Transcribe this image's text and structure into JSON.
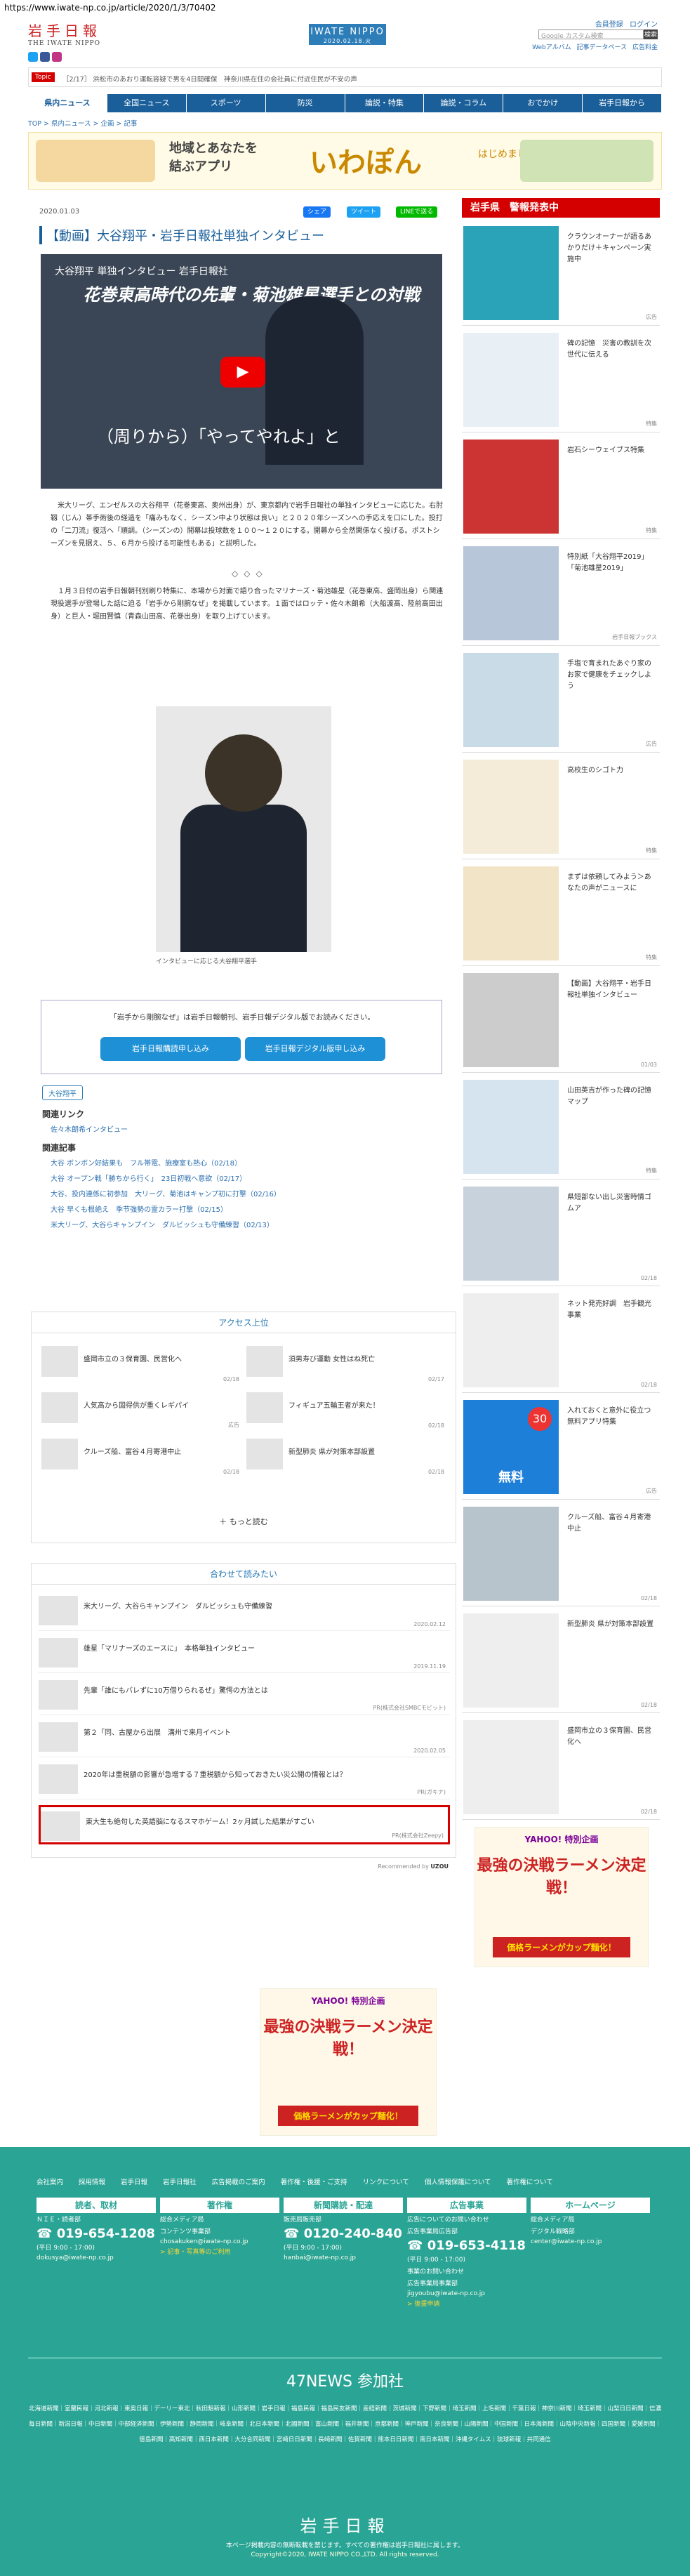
{
  "url": "https://www.iwate-np.co.jp/article/2020/1/3/70402",
  "header": {
    "logo": "岩手日報",
    "logo_sub": "THE IWATE NIPPO",
    "brand": "IWATE NIPPO",
    "brand_date": "2020.02.18.火",
    "links": [
      "会員登録",
      "ログイン"
    ],
    "search_placeholder": "Google カスタム検索",
    "search_btn": "検索",
    "sub_links": [
      "Webアルバム",
      "記事データベース",
      "広告料金"
    ]
  },
  "ticker": {
    "tag": "Topic",
    "text": "［2/17］ 浜松市のあおり運転容疑で男を4日間確保　神奈川県在住の会社員に付近住民が不安の声"
  },
  "nav": [
    "県内ニュース",
    "全国ニュース",
    "スポーツ",
    "防災",
    "論説・特集",
    "論説・コラム",
    "おでかけ",
    "岩手日報から"
  ],
  "breadcrumb": "TOP > 県内ニュース > 企画 > 記事",
  "banner": {
    "text1": "地域とあなたを",
    "text2": "結ぶアプリ",
    "logo": "いわぽん",
    "text3": "はじめました"
  },
  "article": {
    "date": "2020.01.03",
    "share": [
      "シェア",
      "ツイート",
      "LINEで送る"
    ],
    "title": "【動画】大谷翔平・岩手日報社単独インタビュー",
    "video_top": "大谷翔平 単独インタビュー 岩手日報社",
    "video_main": "花巻東高時代の先輩・菊池雄星選手との対戦",
    "video_sub": "（周りから）「やってやれよ」と",
    "body1": "　米大リーグ、エンゼルスの大谷翔平（花巻東高、奥州出身）が、東京都内で岩手日報社の単独インタビューに応じた。右肘靱（じん）帯手術後の経過を「痛みもなく、シーズン中より状態は良い」と２０２０年シーズンへの手応えを口にした。投打の「二刀流」復活へ「順調。（シーズンの）開幕は投球数を１００～１２０にする。開幕から全然関係なく投げる。ポストシーズンを見据え、５、６月から投げる可能性もある」と説明した。",
    "diamonds": "◇◇◇",
    "body2": "　１月３日付の岩手日報朝刊別刷り特集に、本場から対面で語り合ったマリナーズ・菊池雄星（花巻東高、盛岡出身）ら関連現役選手が登場した話に迫る「岩手から剛腕なぜ」を掲載しています。１面ではロッテ・佐々木朗希（大船渡高、陸前高田出身）と巨人・堀田賢慎（青森山田高、花巻出身）を取り上げています。",
    "caption": "インタビューに応じる大谷翔平選手",
    "subscribe_text": "「岩手から剛腕なぜ」は岩手日報朝刊、岩手日報デジタル版でお読みください。",
    "subscribe_btn1": "岩手日報購読申し込み",
    "subscribe_btn2": "岩手日報デジタル版申し込み",
    "tag": "大谷翔平",
    "related_link_head": "関連リンク",
    "related_links": [
      "佐々木朗希インタビュー"
    ],
    "related_articles_head": "関連記事",
    "related_articles": [
      "大谷 ボンボン好結果も　フル帯電、施療室も熱心（02/18）",
      "大谷 オープン戦「勝ちから行く」　23日初戦へ意欲（02/17）",
      "大谷、投内連係に初参加　大リーグ、菊池はキャンプ初に打撃（02/16）",
      "大谷 早くも根絶え　季节強勢の霊カラー打撃（02/15）",
      "米大リーグ、大谷らキャンプイン　ダルビッシュも守備練習（02/13）"
    ]
  },
  "access": {
    "head": "アクセス上位",
    "items": [
      {
        "title": "盛岡市立の３保育園、民営化へ",
        "date": "02/18"
      },
      {
        "title": "須男寿び運動 女性はね死亡",
        "date": "02/17"
      },
      {
        "title": "人気高から固得供が重くレギパイ",
        "date": "広告"
      },
      {
        "title": "フィギュア五輪王者が来た！",
        "date": "02/18"
      },
      {
        "title": "クルーズ船、富谷４月寄港中止",
        "date": "02/18"
      },
      {
        "title": "新型肺炎 県が対策本部設置",
        "date": "02/18"
      }
    ],
    "more": "もっと読む"
  },
  "recommend": {
    "head": "合わせて読みたい",
    "items": [
      {
        "title": "米大リーグ、大谷らキャンプイン　ダルビッシュも守備練習",
        "date": "2020.02.12"
      },
      {
        "title": "雄星「マリナーズのエースに」　本格単独インタビュー",
        "date": "2019.11.19"
      },
      {
        "title": "先輩「誰にもバレずに10万借りられるぜ」驚愕の方法とは",
        "date": "PR(株式会社SMBCモビット)"
      },
      {
        "title": "第２「同、古屋から出展　溝州で来月イベント",
        "date": "2020.02.05"
      },
      {
        "title": "2020年は重税額の影響が急増する７重税額から知っておきたい災公開の情報とは？",
        "date": "PR(ガキナ)"
      },
      {
        "title": "東大生も絶句した英語脳になるスマホゲーム！2ヶ月試した結果がすごい",
        "date": "PR(株式会社Zeepy)"
      }
    ],
    "powered": "Recommended by"
  },
  "ad": {
    "yahoo": "YAHOO! 特別企画",
    "main": "最強の決戦ラーメン決定戦！",
    "bar": "価格ラーメンがカップ麺化！"
  },
  "sidebar": {
    "head": "岩手県　警報発表中",
    "items": [
      {
        "title": "クラウンオーナーが語るあかりだけ＋キャンペーン実施中",
        "date": "広告"
      },
      {
        "title": "碑の記憶　災害の教訓を次世代に伝える",
        "date": "特集"
      },
      {
        "title": "岩石シーウェイブス特集",
        "date": "特集"
      },
      {
        "title": "特別紙「大谷翔平2019」「菊池雄星2019」",
        "date": "岩手日報ブックス"
      },
      {
        "title": "手塩で育まれたあぐり家のお家で健康をチェックしよう",
        "date": "広告"
      },
      {
        "title": "高校生のシゴト力",
        "date": "特集"
      },
      {
        "title": "まずは依頼してみよう＞あなたの声がニュースに",
        "date": "特集"
      },
      {
        "title": "【動画】大谷翔平・岩手日報社単独インタビュー",
        "date": "01/03"
      },
      {
        "title": "山田英吉が作った碑の記憶マップ",
        "date": "特集"
      },
      {
        "title": "県短部ない出し災害時情ゴムア",
        "date": "02/18"
      },
      {
        "title": "ネット発売好調　岩手観光事業",
        "date": "02/18"
      },
      {
        "title": "入れておくと意外に役立つ無料アプリ特集",
        "date": "広告"
      },
      {
        "title": "クルーズ船、富谷４月寄港中止",
        "date": "02/18"
      },
      {
        "title": "新型肺炎 県が対策本部設置",
        "date": "02/18"
      },
      {
        "title": "盛岡市立の３保育園、民営化へ",
        "date": "02/18"
      }
    ],
    "badge": "30",
    "badge_label": "無料"
  },
  "footer": {
    "links": [
      "会社案内",
      "採用情報",
      "岩手日報",
      "岩手日報社",
      "広告掲載のご案内",
      "著作権・後援・ご支持",
      "リンクについて",
      "個人情報保護について",
      "著作権について"
    ],
    "cols": [
      {
        "head": "読者、取材",
        "l1": "ＮＩＥ・読者部",
        "phone": "019-654-1208",
        "hours": "(平日 9:00 - 17:00)",
        "mail": "dokusya@iwate-np.co.jp"
      },
      {
        "head": "著作権",
        "l1": "総合メディア局",
        "l2": "コンテンツ事業部",
        "mail": "chosakuken@iwate-np.co.jp",
        "note": "記事・写真等のご利用"
      },
      {
        "head": "新聞購読・配達",
        "l1": "販売局販売部",
        "phone": "0120-240-840",
        "hours": "(平日 9:00 - 17:00)",
        "mail": "hanbai@iwate-np.co.jp"
      },
      {
        "head": "広告事業",
        "l1": "広告についてのお問い合わせ",
        "l2": "広告事業局広告部",
        "phone": "019-653-4118",
        "hours": "(平日 9:00 - 17:00)",
        "l3": "事業のお問い合わせ",
        "l4": "広告事業局事業部",
        "mail": "jigyoubu@iwate-np.co.jp",
        "note": "後援申請"
      },
      {
        "head": "ホームページ",
        "l1": "総合メディア局",
        "l2": "デジタル戦略部",
        "mail": "center@iwate-np.co.jp"
      }
    ],
    "n47": "47NEWS 参加社",
    "partners": "北海道新聞｜室蘭民報｜河北新報｜東奥日報｜デーリー東北｜秋田魁新報｜山形新聞｜岩手日報｜福島民報｜福島民友新聞｜産経新聞｜茨城新聞｜下野新聞｜埼玉新聞｜上毛新聞｜千葉日報｜神奈川新聞｜埼玉新聞｜山梨日日新聞｜信濃毎日新聞｜新潟日報｜中日新聞｜中部経済新聞｜伊勢新聞｜静岡新聞｜岐阜新聞｜北日本新聞｜北國新聞｜富山新聞｜福井新聞｜京都新聞｜神戸新聞｜奈良新聞｜山陽新聞｜中国新聞｜日本海新聞｜山陰中央新報｜四国新聞｜愛媛新聞｜徳島新聞｜高知新聞｜西日本新聞｜大分合同新聞｜宮崎日日新聞｜長崎新聞｜佐賀新聞｜熊本日日新聞｜南日本新聞｜沖縄タイムス｜琉球新報｜共同通信",
    "logo": "岩手日報",
    "copy1": "本ページ掲載内容の無断転載を禁じます。すべての著作権は岩手日報社に属します。",
    "copy2": "Copyright©2020, IWATE NIPPO CO.,LTD. All rights reserved."
  }
}
